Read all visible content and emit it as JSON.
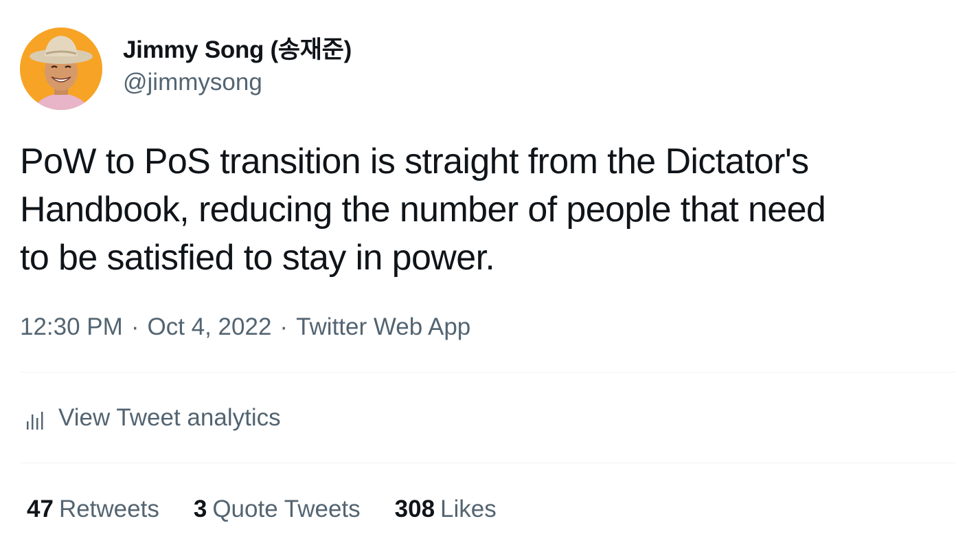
{
  "author": {
    "display_name": "Jimmy Song (송재준)",
    "handle": "@jimmysong"
  },
  "tweet": {
    "text": "PoW to PoS transition is straight from the Dictator's\nHandbook, reducing the number of people that need\nto be satisfied to stay in power."
  },
  "meta": {
    "time": "12:30 PM",
    "separator": "·",
    "date": "Oct 4, 2022",
    "source": "Twitter Web App"
  },
  "analytics": {
    "icon": "bar-chart-icon",
    "label": "View Tweet analytics"
  },
  "stats": {
    "retweets": {
      "count": "47",
      "label": "Retweets"
    },
    "quotes": {
      "count": "3",
      "label": "Quote Tweets"
    },
    "likes": {
      "count": "308",
      "label": "Likes"
    }
  },
  "colors": {
    "text_primary": "#0f1419",
    "text_secondary": "#536471",
    "divider": "#eff3f4",
    "avatar_background": "#f7a325"
  }
}
